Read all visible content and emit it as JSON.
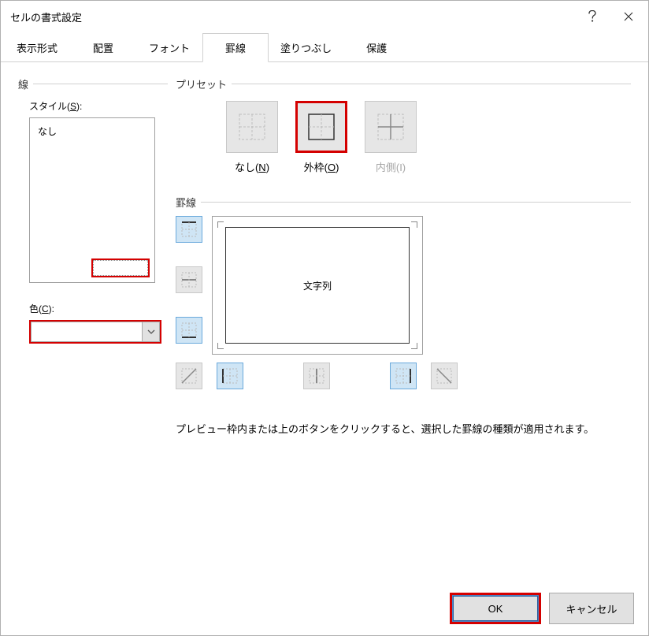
{
  "title": "セルの書式設定",
  "tabs": [
    "表示形式",
    "配置",
    "フォント",
    "罫線",
    "塗りつぶし",
    "保護"
  ],
  "activeTab": 3,
  "leftPanel": {
    "groupLabel": "線",
    "styleLabel": "スタイル(S):",
    "styleNone": "なし",
    "colorLabel": "色(C):",
    "colorValue": ""
  },
  "presets": {
    "groupLabel": "プリセット",
    "items": [
      {
        "label": "なし(N)",
        "key": "none"
      },
      {
        "label": "外枠(O)",
        "key": "outline",
        "highlight": true
      },
      {
        "label": "内側(I)",
        "key": "inside",
        "disabled": true
      }
    ]
  },
  "borderSection": {
    "groupLabel": "罫線",
    "previewText": "文字列"
  },
  "hint": "プレビュー枠内または上のボタンをクリックすると、選択した罫線の種類が適用されます。",
  "buttons": {
    "ok": "OK",
    "cancel": "キャンセル"
  }
}
